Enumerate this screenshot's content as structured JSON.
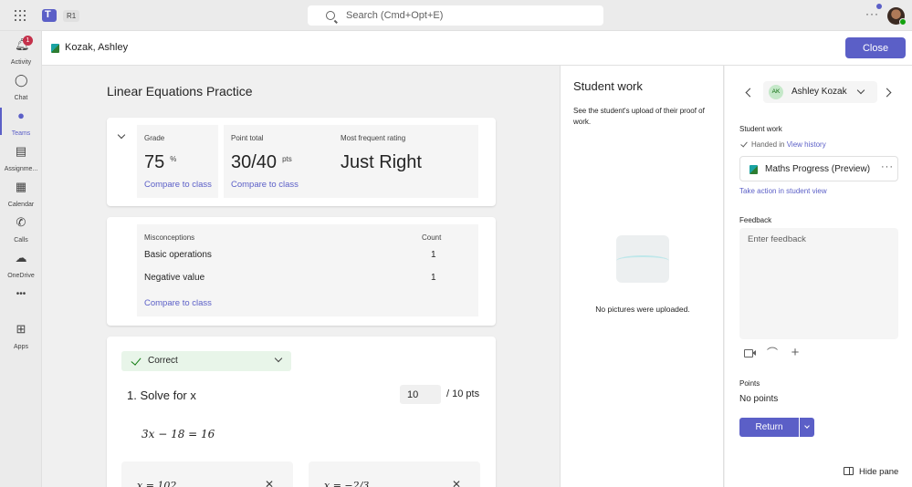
{
  "topbar": {
    "ring_label": "R1",
    "search_placeholder": "Search (Cmd+Opt+E)",
    "more_label": "···"
  },
  "rail": {
    "items": [
      {
        "label": "Activity",
        "icon": "bell-icon",
        "badge": "1"
      },
      {
        "label": "Chat",
        "icon": "chat-icon"
      },
      {
        "label": "Teams",
        "icon": "teams-icon"
      },
      {
        "label": "Assignme...",
        "icon": "assignments-icon"
      },
      {
        "label": "Calendar",
        "icon": "calendar-icon"
      },
      {
        "label": "Calls",
        "icon": "phone-icon"
      },
      {
        "label": "OneDrive",
        "icon": "cloud-icon"
      },
      {
        "label": "•••",
        "icon": "more-icon"
      },
      {
        "label": "Apps",
        "icon": "apps-icon"
      }
    ]
  },
  "header": {
    "student_name": "Kozak, Ashley",
    "close_label": "Close"
  },
  "main": {
    "title": "Linear Equations Practice",
    "grade": {
      "label": "Grade",
      "value": "75",
      "unit": "%",
      "compare": "Compare to class"
    },
    "points": {
      "label": "Point total",
      "value": "30/40",
      "unit": "pts",
      "compare": "Compare to class"
    },
    "rating": {
      "label": "Most frequent rating",
      "value": "Just Right"
    },
    "misconceptions": {
      "header": "Misconceptions",
      "count_header": "Count",
      "rows": [
        {
          "name": "Basic operations",
          "count": "1"
        },
        {
          "name": "Negative value",
          "count": "1"
        }
      ],
      "compare": "Compare to class"
    },
    "question": {
      "status": "Correct",
      "text": "1.  Solve for x",
      "points_value": "10",
      "points_total": "/ 10 pts",
      "equation": "3x − 18 = 16",
      "answers": [
        "x = 102",
        "x = −2/3"
      ]
    }
  },
  "middle": {
    "title": "Student work",
    "description": "See the student's upload of their proof of work.",
    "empty_text": "No pictures were uploaded."
  },
  "right": {
    "initials": "AK",
    "student_name": "Ashley Kozak",
    "student_work_label": "Student work",
    "handed_in": "Handed in",
    "view_history": "View history",
    "file_name": "Maths Progress (Preview)",
    "file_more": "···",
    "take_action": "Take action in student view",
    "feedback_label": "Feedback",
    "feedback_placeholder": "Enter feedback",
    "points_label": "Points",
    "points_value": "No points",
    "return_label": "Return",
    "hide_pane": "Hide pane"
  },
  "colors": {
    "accent": "#5b5fc7",
    "correct_bg": "#e8f5e9",
    "check": "#107c10",
    "badge": "#c4314b"
  }
}
